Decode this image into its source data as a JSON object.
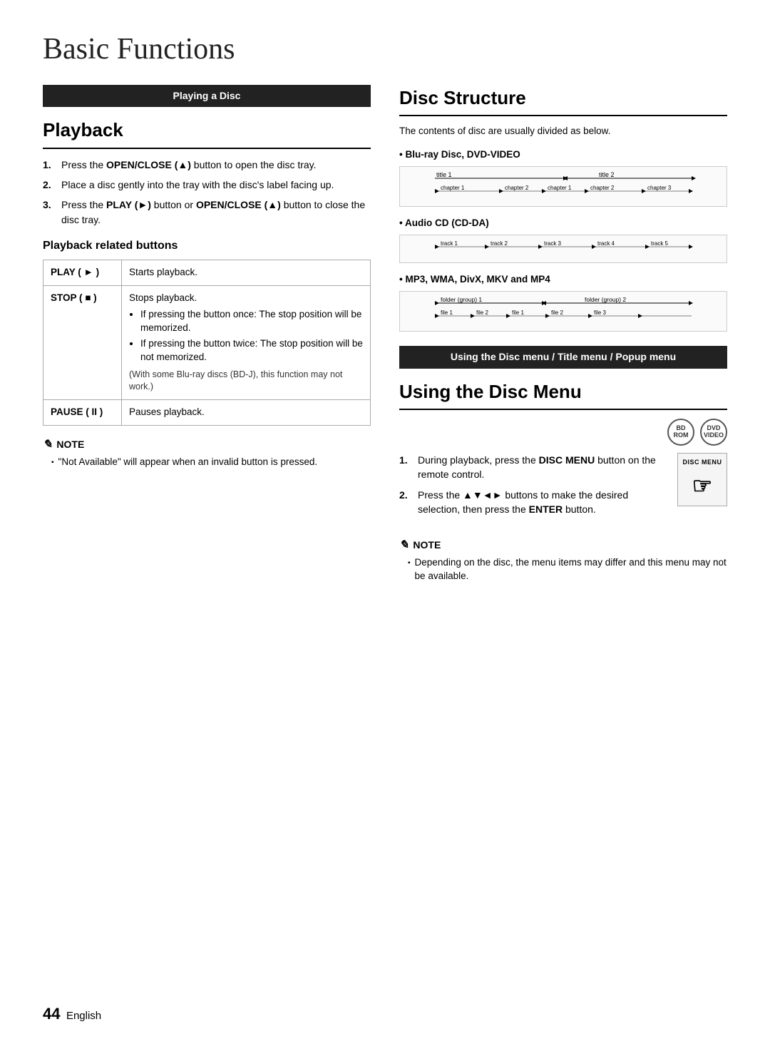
{
  "page": {
    "title": "Basic Functions",
    "footer_page": "44",
    "footer_lang": "English"
  },
  "left": {
    "banner": "Playing a Disc",
    "playback_heading": "Playback",
    "steps": [
      {
        "num": "1.",
        "text_before": "Press the ",
        "bold": "OPEN/CLOSE (▲)",
        "text_after": " button to open the disc tray."
      },
      {
        "num": "2.",
        "text_before": "",
        "bold": "",
        "text_after": "Place a disc gently into the tray with the disc's label facing up."
      },
      {
        "num": "3.",
        "text_before": "Press the ",
        "bold": "PLAY (►)",
        "text_after": " button or ",
        "bold2": "OPEN/CLOSE (▲)",
        "text_after2": " button to close the disc tray."
      }
    ],
    "playback_buttons_heading": "Playback related buttons",
    "table_rows": [
      {
        "key": "PLAY ( ► )",
        "value": "Starts playback.",
        "type": "simple"
      },
      {
        "key": "STOP ( ■ )",
        "value_intro": "Stops playback.",
        "bullets": [
          "If pressing the button once: The stop position will be memorized.",
          "If pressing the button twice: The stop position will be not memorized."
        ],
        "footnote": "(With some Blu-ray discs (BD-J), this function may not work.)",
        "type": "stop"
      },
      {
        "key": "PAUSE ( II )",
        "value": "Pauses playback.",
        "type": "simple"
      }
    ],
    "note_title": "NOTE",
    "note_items": [
      "\"Not Available\" will appear when an invalid button is pressed."
    ]
  },
  "right": {
    "disc_structure_heading": "Disc Structure",
    "disc_structure_desc": "The contents of disc are usually divided as below.",
    "disc_types": [
      {
        "label": "Blu-ray Disc, DVD-VIDEO",
        "timeline_type": "bluray"
      },
      {
        "label": "Audio CD (CD-DA)",
        "timeline_type": "audiocd"
      },
      {
        "label": "MP3, WMA, DivX, MKV and MP4",
        "timeline_type": "mp3"
      }
    ],
    "disc_menu_banner": "Using the Disc menu / Title menu / Popup menu",
    "disc_menu_heading": "Using the Disc Menu",
    "disc_menu_icons": [
      "BD-ROM",
      "DVD-VIDEO"
    ],
    "disc_menu_img_label": "DISC MENU",
    "steps": [
      {
        "num": "1.",
        "text_before": "During playback, press the ",
        "bold": "DISC MENU",
        "text_after": " button on the remote control."
      },
      {
        "num": "2.",
        "text_before": "Press the ▲▼◄► buttons to make the desired selection, then press the ",
        "bold": "ENTER",
        "text_after": " button."
      }
    ],
    "note_title": "NOTE",
    "note_items": [
      "Depending on the disc, the menu items may differ and this menu may not be available."
    ]
  }
}
